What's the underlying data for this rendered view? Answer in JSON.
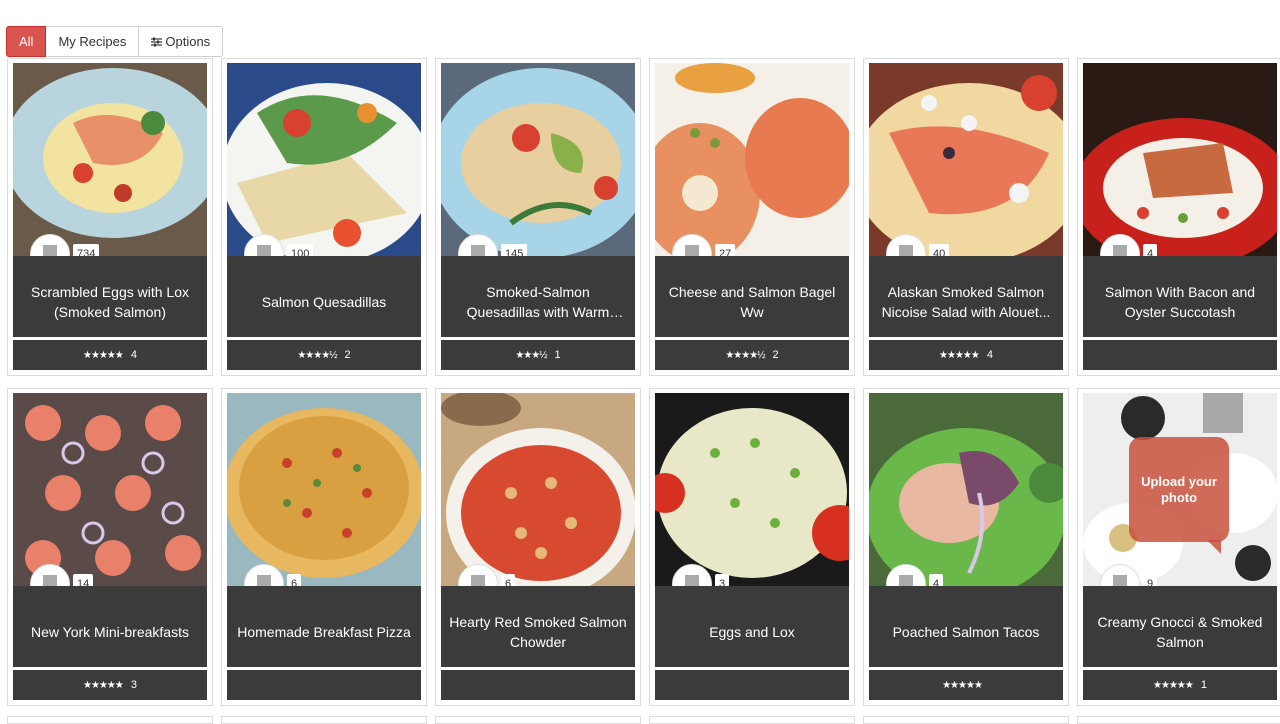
{
  "filters": {
    "all": "All",
    "my_recipes": "My Recipes",
    "options": "Options"
  },
  "cards": [
    {
      "title": "Scrambled Eggs with Lox (Smoked Salmon)",
      "saves": "734",
      "stars": "★★★★★",
      "rating_count": "4"
    },
    {
      "title": "Salmon Quesadillas",
      "saves": "100",
      "stars": "★★★★½",
      "rating_count": "2"
    },
    {
      "title": "Smoked-Salmon Quesadillas with Warm Tomatoes an...",
      "saves": "145",
      "stars": "★★★½",
      "rating_count": "1"
    },
    {
      "title": "Cheese and Salmon Bagel Ww",
      "saves": "27",
      "stars": "★★★★½",
      "rating_count": "2"
    },
    {
      "title": "Alaskan Smoked Salmon Nicoise Salad with Alouet...",
      "saves": "40",
      "stars": "★★★★★",
      "rating_count": "4"
    },
    {
      "title": "Salmon With Bacon and Oyster Succotash",
      "saves": "4",
      "stars": "",
      "rating_count": ""
    },
    {
      "title": "New York Mini-breakfasts",
      "saves": "14",
      "stars": "★★★★★",
      "rating_count": "3"
    },
    {
      "title": "Homemade Breakfast Pizza",
      "saves": "6",
      "stars": "",
      "rating_count": ""
    },
    {
      "title": "Hearty Red Smoked Salmon Chowder",
      "saves": "6",
      "stars": "",
      "rating_count": ""
    },
    {
      "title": "Eggs and Lox",
      "saves": "3",
      "stars": "",
      "rating_count": ""
    },
    {
      "title": "Poached Salmon Tacos",
      "saves": "4",
      "stars": "★★★★★",
      "rating_count": ""
    },
    {
      "title": "Creamy Gnocci & Smoked Salmon",
      "saves": "9",
      "stars": "★★★★★",
      "rating_count": "1",
      "upload_prompt": "Upload your photo"
    }
  ],
  "colors": {
    "accent": "#d9534f",
    "card_dark": "#3b3b3b"
  },
  "icons": {
    "save": "bookmark-icon",
    "options": "sliders-icon",
    "rating": "star-icon"
  }
}
